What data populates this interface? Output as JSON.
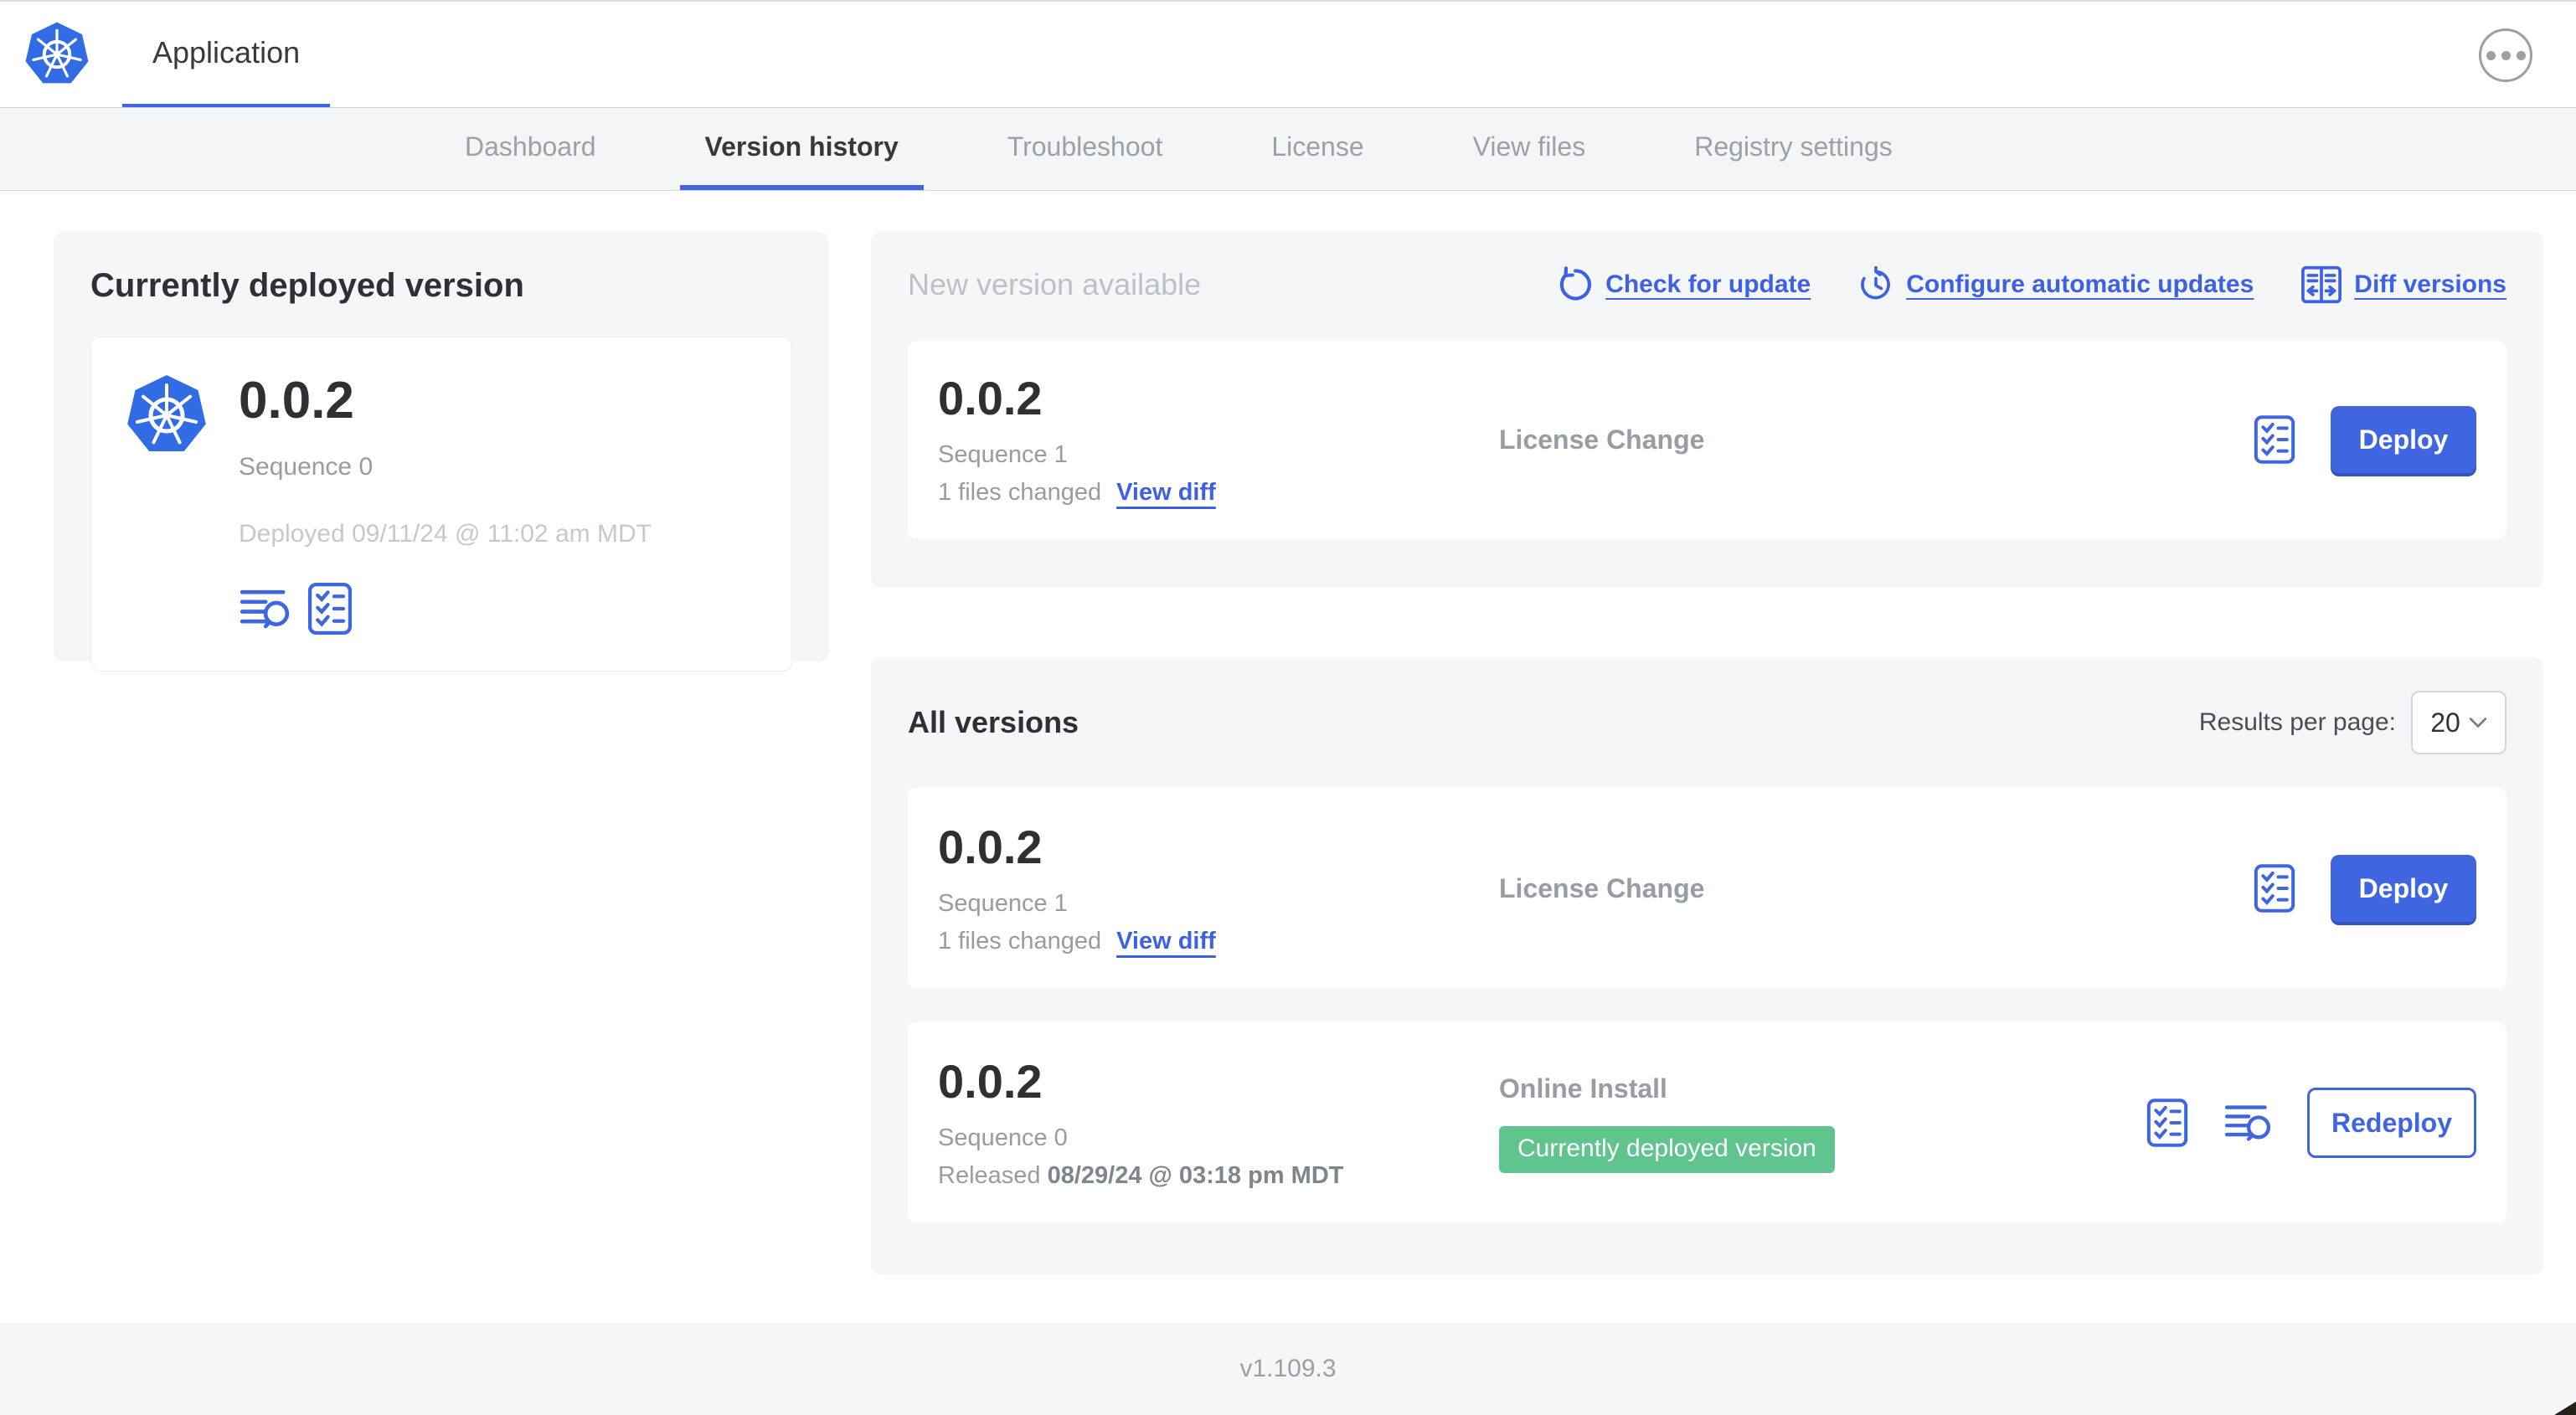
{
  "header": {
    "app_title": "Application"
  },
  "nav": {
    "tabs": [
      {
        "label": "Dashboard",
        "active": false
      },
      {
        "label": "Version history",
        "active": true
      },
      {
        "label": "Troubleshoot",
        "active": false
      },
      {
        "label": "License",
        "active": false
      },
      {
        "label": "View files",
        "active": false
      },
      {
        "label": "Registry settings",
        "active": false
      }
    ]
  },
  "current_version_card": {
    "title": "Currently deployed version",
    "version": "0.0.2",
    "sequence": "Sequence 0",
    "deployed_at": "Deployed 09/11/24 @ 11:02 am MDT"
  },
  "new_version_section": {
    "title": "New version available",
    "actions": [
      {
        "label": "Check for update",
        "icon": "refresh-icon"
      },
      {
        "label": "Configure automatic updates",
        "icon": "clock-arrow-icon"
      },
      {
        "label": "Diff versions",
        "icon": "diff-icon"
      }
    ],
    "card": {
      "version": "0.0.2",
      "sequence": "Sequence 1",
      "files_changed": "1 files changed",
      "view_diff_label": "View diff",
      "source": "License Change",
      "deploy_label": "Deploy"
    }
  },
  "all_versions_section": {
    "title": "All versions",
    "results_per_page_label": "Results per page:",
    "results_per_page_value": "20",
    "rows": [
      {
        "version": "0.0.2",
        "sequence": "Sequence 1",
        "files_changed": "1 files changed",
        "view_diff_label": "View diff",
        "source": "License Change",
        "action_label": "Deploy"
      },
      {
        "version": "0.0.2",
        "sequence": "Sequence 0",
        "released_prefix": "Released",
        "released_date": "08/29/24 @ 03:18 pm MDT",
        "source": "Online Install",
        "badge": "Currently deployed version",
        "action_label": "Redeploy"
      }
    ]
  },
  "footer": {
    "app_version": "v1.109.3"
  },
  "icons": {
    "app_logo": "kubernetes-wheel",
    "overflow": "ellipsis",
    "check_for_update": "refresh-arrow",
    "configure_updates": "clock-arrow",
    "diff_versions": "split-diff",
    "release_notes": "checklist",
    "logs": "log-search",
    "select_chevron": "chevron-down"
  },
  "colors": {
    "accent_blue": "#4065E0",
    "logo_blue": "#326CE5",
    "badge_green": "#5FC48E",
    "bg_gray": "#F5F6F8",
    "border_gray": "#D0D4D7",
    "text_dark": "#2F3033",
    "text_gray": "#9B9B9B",
    "text_light_gray": "#C5C8CC",
    "link_blue": "#3E61E4"
  }
}
